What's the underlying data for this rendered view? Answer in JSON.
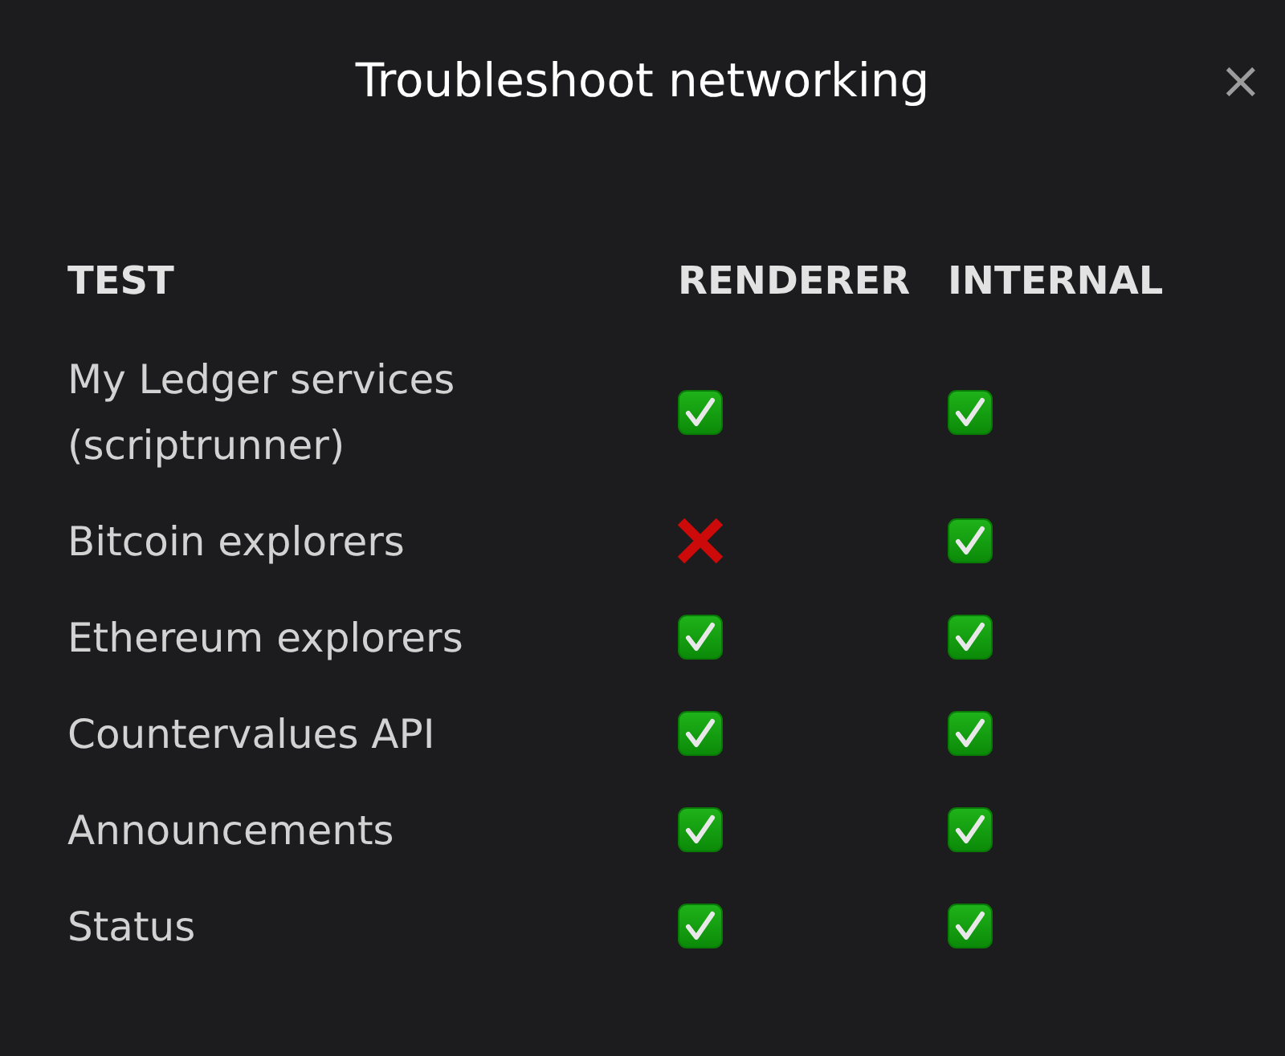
{
  "window": {
    "title": "Troubleshoot networking",
    "close_label": "×"
  },
  "table": {
    "columns": [
      "TEST",
      "RENDERER",
      "INTERNAL"
    ],
    "rows": [
      {
        "test": "My Ledger services (scriptrunner)",
        "renderer": {
          "passed": true
        },
        "internal": {
          "passed": true
        }
      },
      {
        "test": "Bitcoin explorers",
        "renderer": {
          "passed": false
        },
        "internal": {
          "passed": true
        }
      },
      {
        "test": "Ethereum explorers",
        "renderer": {
          "passed": true
        },
        "internal": {
          "passed": true
        }
      },
      {
        "test": "Countervalues API",
        "renderer": {
          "passed": true
        },
        "internal": {
          "passed": true
        }
      },
      {
        "test": "Announcements",
        "renderer": {
          "passed": true
        },
        "internal": {
          "passed": true
        }
      },
      {
        "test": "Status",
        "renderer": {
          "passed": true
        },
        "internal": {
          "passed": true
        }
      }
    ]
  }
}
